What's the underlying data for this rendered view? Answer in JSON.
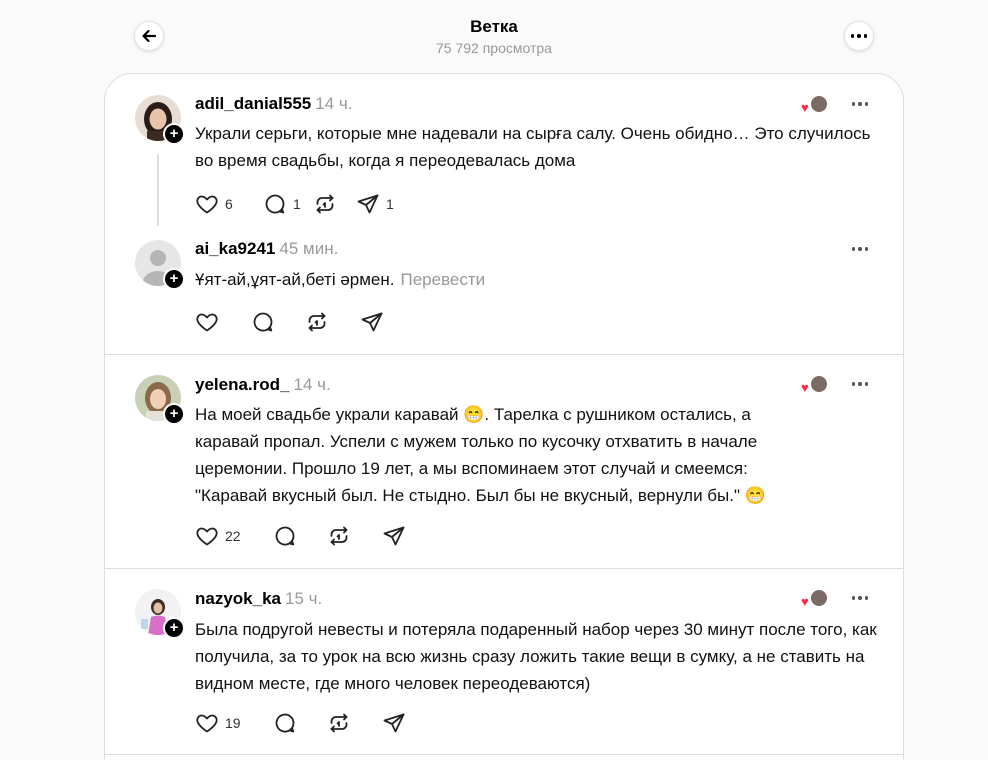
{
  "header": {
    "title": "Ветка",
    "views": "75 792 просмотра"
  },
  "icons": {
    "back": "arrow-left-icon",
    "more": "more-horizontal-icon",
    "like": "heart-icon",
    "reply": "comment-icon",
    "repost": "repost-icon",
    "share": "send-icon"
  },
  "posts": [
    {
      "username": "adil_danial555",
      "time": "14 ч.",
      "text": "Украли серьги, которые мне надевали на сырға салу. Очень обидно… Это случилось во время свадьбы, когда я переодевалась дома",
      "likes": "6",
      "replies": "1",
      "reposts": "",
      "shares": "1"
    },
    {
      "username": "ai_ka9241",
      "time": "45 мин.",
      "text": "Ұят-ай,ұят-ай,беті әрмен.",
      "translate": "Перевести",
      "likes": "",
      "replies": "",
      "reposts": "",
      "shares": ""
    },
    {
      "username": "yelena.rod_",
      "time": "14 ч.",
      "text_lines": [
        "На моей свадьбе украли каравай 😁. Тарелка с рушником остались, а",
        "каравай пропал. Успели с мужем только по кусочку отхватить в начале",
        "церемонии. Прошло 19 лет, а мы вспоминаем этот случай и смеемся:",
        "\"Каравай вкусный был. Не стыдно. Был бы не вкусный, вернули бы.\" 😁"
      ],
      "likes": "22",
      "replies": "",
      "reposts": "",
      "shares": ""
    },
    {
      "username": "nazyok_ka",
      "time": "15 ч.",
      "text": "Была подругой невесты и потеряла подаренный набор через 30 минут после того, как получила, за то урок на всю жизнь сразу ложить такие вещи в сумку, а не ставить на видном месте, где много человек переодеваются)",
      "likes": "19",
      "replies": "",
      "reposts": "",
      "shares": ""
    }
  ]
}
